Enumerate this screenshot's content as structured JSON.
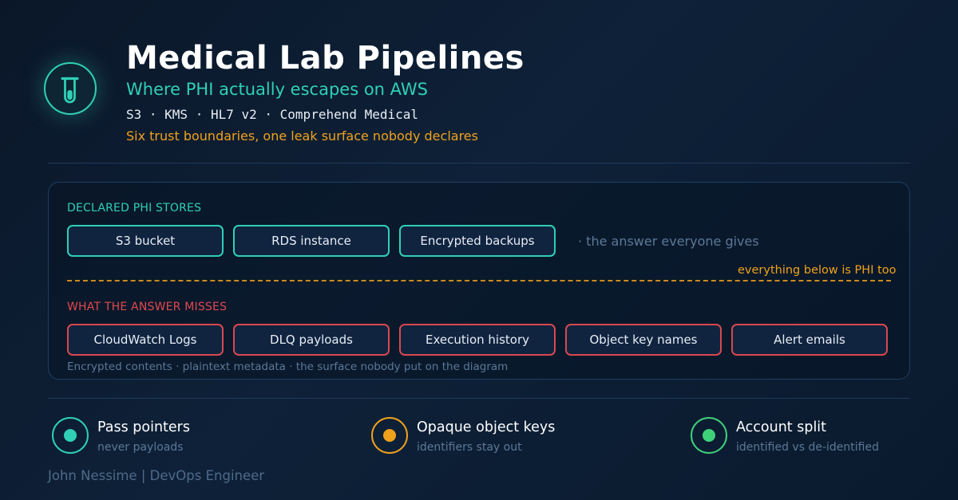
{
  "header": {
    "title": "Medical Lab Pipelines",
    "subtitle": "Where PHI actually escapes on AWS",
    "tech_line": "S3 · KMS · HL7 v2 · Comprehend Medical",
    "tagline": "Six trust boundaries, one leak surface nobody declares",
    "logo_icon": "test-tube-icon"
  },
  "panel": {
    "declared": {
      "label": "DECLARED PHI STORES",
      "items": [
        "S3 bucket",
        "RDS instance",
        "Encrypted backups"
      ],
      "aside": "· the answer everyone gives",
      "color": "#2fd0b6"
    },
    "boundary_note": "everything below is PHI too",
    "misses": {
      "label": "WHAT THE ANSWER MISSES",
      "items": [
        "CloudWatch Logs",
        "DLQ payloads",
        "Execution history",
        "Object key names",
        "Alert emails"
      ],
      "color": "#e0484e"
    },
    "footnote": "Encrypted contents · plaintext metadata · the surface nobody put on the diagram"
  },
  "principles": [
    {
      "title": "Pass pointers",
      "subtitle": "never payloads",
      "color": "#2fd0b6"
    },
    {
      "title": "Opaque object keys",
      "subtitle": "identifiers stay out",
      "color": "#f0a21c"
    },
    {
      "title": "Account split",
      "subtitle": "identified vs de-identified",
      "color": "#3fd17a"
    }
  ],
  "author": "John Nessime | DevOps Engineer"
}
